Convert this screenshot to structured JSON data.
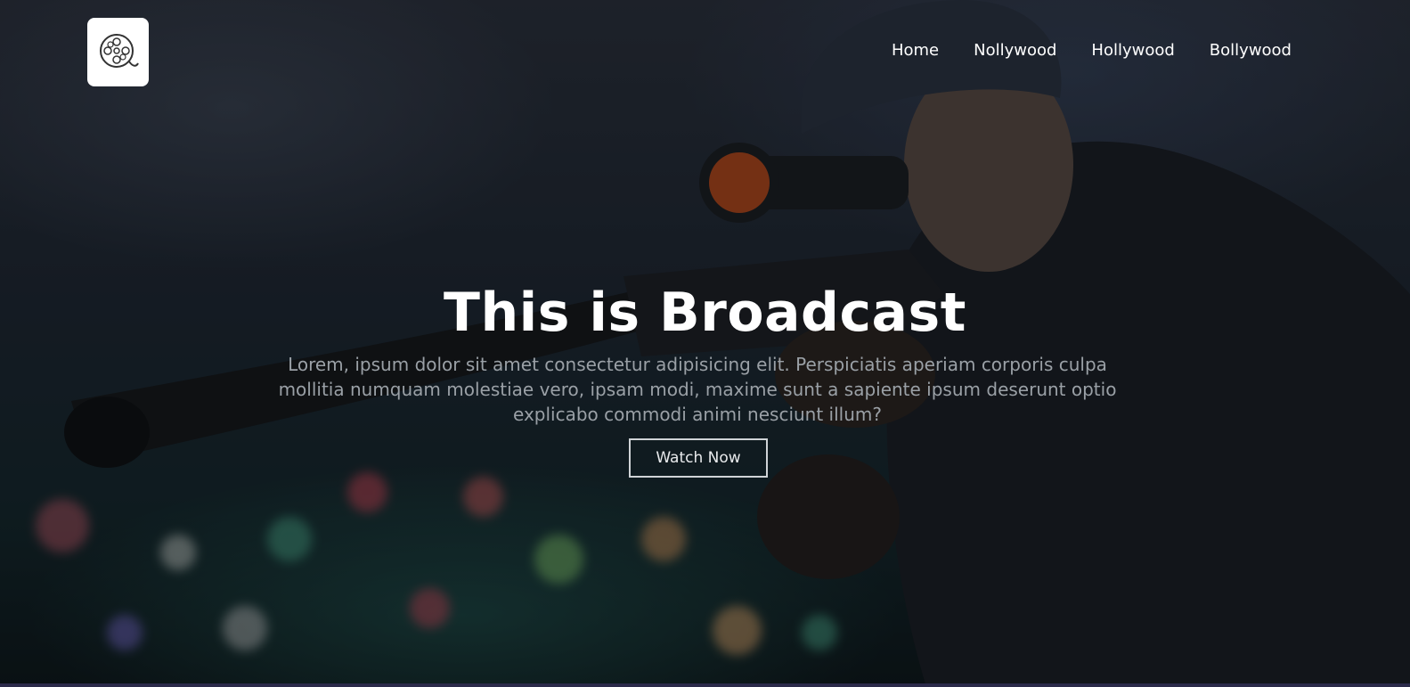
{
  "logo": {
    "icon": "film-reel-icon"
  },
  "nav": {
    "items": [
      {
        "label": "Home"
      },
      {
        "label": "Nollywood"
      },
      {
        "label": "Hollywood"
      },
      {
        "label": "Bollywood"
      }
    ]
  },
  "hero": {
    "title": "This is Broadcast",
    "description": "Lorem, ipsum dolor sit amet consectetur adipisicing elit. Perspiciatis aperiam corporis culpa mollitia numquam molestiae vero, ipsam modi, maxime sunt a sapiente ipsum deserunt optio explicabo commodi animi nesciunt illum?",
    "cta_label": "Watch Now",
    "background_image": "sniper-with-rifle-image"
  },
  "colors": {
    "title": "#ffffff",
    "description": "#9aa0a6",
    "button_border": "#cfd3d6"
  }
}
